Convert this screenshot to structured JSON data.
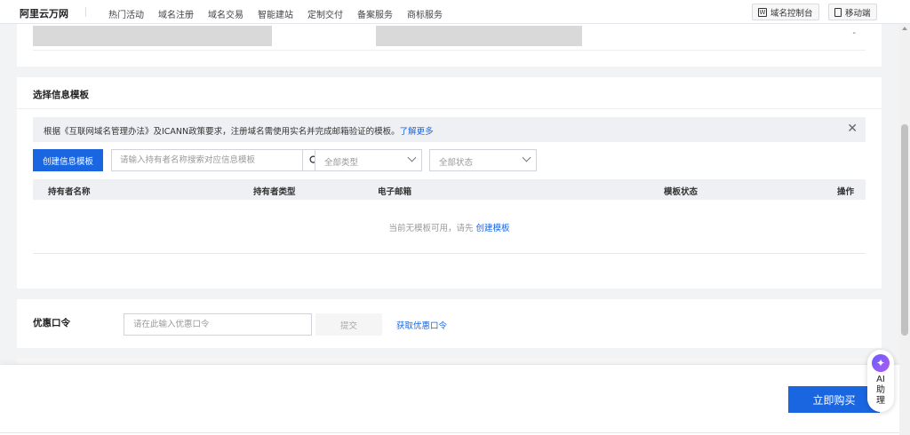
{
  "header": {
    "brand": "阿里云万网",
    "nav": [
      "热门活动",
      "域名注册",
      "域名交易",
      "智能建站",
      "定制交付",
      "备案服务",
      "商标服务"
    ],
    "console_label": "域名控制台",
    "mobile_label": "移动端",
    "console_icon": "W"
  },
  "top_card": {
    "dash": "-"
  },
  "template_section": {
    "title": "选择信息模板",
    "notice_text": "根据《互联网域名管理办法》及ICANN政策要求，注册域名需使用实名并完成邮箱验证的模板。",
    "notice_link": "了解更多",
    "create_button": "创建信息模板",
    "search_placeholder": "请输入持有者名称搜索对应信息模板",
    "type_select": "全部类型",
    "status_select": "全部状态",
    "columns": [
      "持有者名称",
      "持有者类型",
      "电子邮箱",
      "模板状态",
      "操作"
    ],
    "empty_text": "当前无模板可用，请先",
    "empty_link": "创建模板"
  },
  "coupon": {
    "label": "优惠口令",
    "placeholder": "请在此输入优惠口令",
    "submit": "提交",
    "link": "获取优惠口令"
  },
  "footer": {
    "buy_button": "立即购买"
  },
  "ai_assistant": {
    "label": "AI助理",
    "icon": "✦"
  },
  "colors": {
    "primary": "#1a66e0",
    "bg": "#f2f3f5",
    "table_head": "#eef0f3"
  }
}
